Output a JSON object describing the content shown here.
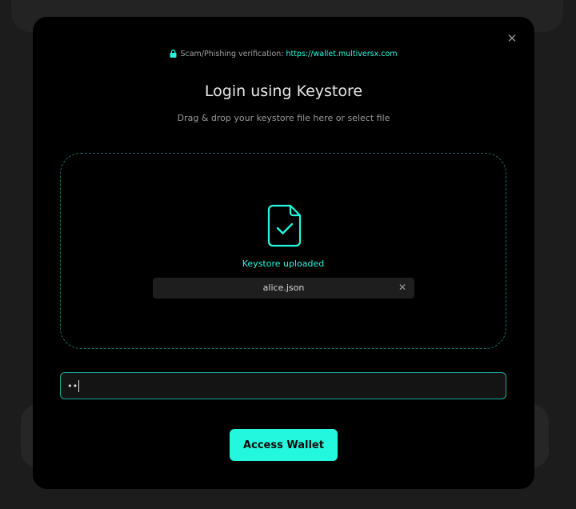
{
  "header": {
    "verification_label": "Scam/Phishing verification:",
    "verification_url": "https://wallet.multiversx.com",
    "close_icon": "close-icon",
    "lock_icon": "lock-icon"
  },
  "title": "Login using Keystore",
  "subtitle": "Drag & drop your keystore file here or select file",
  "dropzone": {
    "icon": "file-check-icon",
    "status": "Keystore uploaded",
    "file_name": "alice.json",
    "remove_icon": "close-icon"
  },
  "password": {
    "value": "••"
  },
  "access_button": "Access Wallet",
  "colors": {
    "accent": "#23f7dd",
    "modal_bg": "#000000",
    "input_border": "#1ba898",
    "dropzone_border": "#1c6b62"
  }
}
